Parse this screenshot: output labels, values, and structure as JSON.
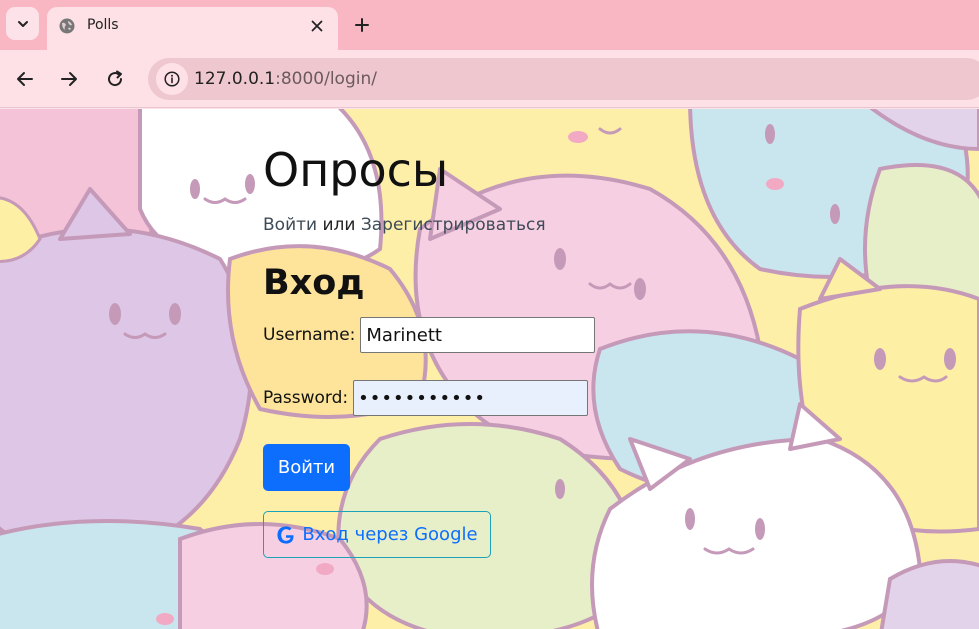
{
  "browser": {
    "tab": {
      "title": "Polls",
      "favicon": "globe-icon"
    },
    "url": {
      "host": "127.0.0.1",
      "rest": ":8000/login/"
    },
    "icons": [
      "chevron-down-icon",
      "close-icon",
      "plus-icon",
      "back-arrow-icon",
      "forward-arrow-icon",
      "reload-icon",
      "info-icon"
    ],
    "colors": {
      "tabstrip": "#f9b6c3",
      "toolbar": "#fde1e7",
      "omnibox": "#efc7cf"
    }
  },
  "page": {
    "title": "Опросы",
    "auth": {
      "login": "Войти",
      "separator": " или ",
      "register": "Зарегистрироваться"
    },
    "form_title": "Вход",
    "username": {
      "label": "Username:",
      "value": "Marinett"
    },
    "password": {
      "label": "Password:",
      "value": "•••••••••••"
    },
    "login_button": "Войти",
    "google_button": {
      "label": "Вход через Google",
      "icon": "google-icon"
    },
    "colors": {
      "primary": "#0d6efd",
      "google_border": "#1aa3b8"
    },
    "background": "pastel cat pattern"
  }
}
